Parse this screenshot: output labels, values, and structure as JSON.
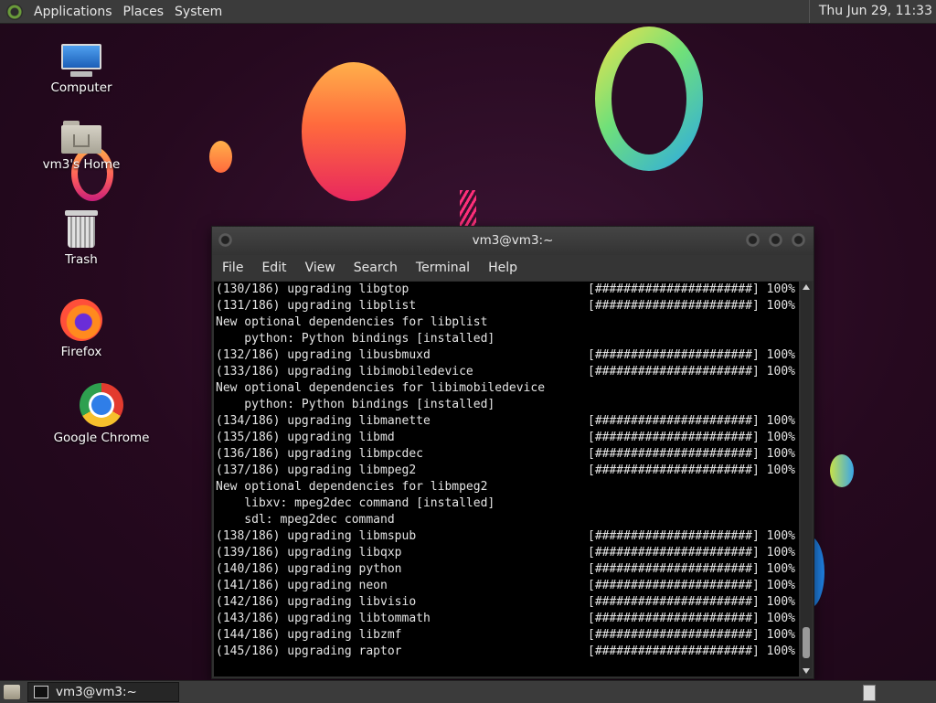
{
  "top_panel": {
    "menus": [
      "Applications",
      "Places",
      "System"
    ],
    "clock": "Thu Jun 29, 11:33"
  },
  "desktop_icons": [
    {
      "label": "Computer",
      "icon": "computer-icon"
    },
    {
      "label": "vm3's Home",
      "icon": "home-folder-icon"
    },
    {
      "label": "Trash",
      "icon": "trash-icon"
    },
    {
      "label": "Firefox",
      "icon": "firefox-icon"
    },
    {
      "label": "Google Chrome",
      "icon": "chrome-icon"
    }
  ],
  "terminal": {
    "title": "vm3@vm3:~",
    "menu": [
      "File",
      "Edit",
      "View",
      "Search",
      "Terminal",
      "Help"
    ],
    "lines": [
      {
        "text": "(130/186) upgrading libgtop",
        "progress": "[######################] 100%"
      },
      {
        "text": "(131/186) upgrading libplist",
        "progress": "[######################] 100%"
      },
      {
        "text": "New optional dependencies for libplist",
        "progress": ""
      },
      {
        "text": "    python: Python bindings [installed]",
        "progress": ""
      },
      {
        "text": "(132/186) upgrading libusbmuxd",
        "progress": "[######################] 100%"
      },
      {
        "text": "(133/186) upgrading libimobiledevice",
        "progress": "[######################] 100%"
      },
      {
        "text": "New optional dependencies for libimobiledevice",
        "progress": ""
      },
      {
        "text": "    python: Python bindings [installed]",
        "progress": ""
      },
      {
        "text": "(134/186) upgrading libmanette",
        "progress": "[######################] 100%"
      },
      {
        "text": "(135/186) upgrading libmd",
        "progress": "[######################] 100%"
      },
      {
        "text": "(136/186) upgrading libmpcdec",
        "progress": "[######################] 100%"
      },
      {
        "text": "(137/186) upgrading libmpeg2",
        "progress": "[######################] 100%"
      },
      {
        "text": "New optional dependencies for libmpeg2",
        "progress": ""
      },
      {
        "text": "    libxv: mpeg2dec command [installed]",
        "progress": ""
      },
      {
        "text": "    sdl: mpeg2dec command",
        "progress": ""
      },
      {
        "text": "(138/186) upgrading libmspub",
        "progress": "[######################] 100%"
      },
      {
        "text": "(139/186) upgrading libqxp",
        "progress": "[######################] 100%"
      },
      {
        "text": "(140/186) upgrading python",
        "progress": "[######################] 100%"
      },
      {
        "text": "(141/186) upgrading neon",
        "progress": "[######################] 100%"
      },
      {
        "text": "(142/186) upgrading libvisio",
        "progress": "[######################] 100%"
      },
      {
        "text": "(143/186) upgrading libtommath",
        "progress": "[######################] 100%"
      },
      {
        "text": "(144/186) upgrading libzmf",
        "progress": "[######################] 100%"
      },
      {
        "text": "(145/186) upgrading raptor",
        "progress": "[######################] 100%"
      }
    ]
  },
  "taskbar": {
    "tasks": [
      {
        "label": "vm3@vm3:~"
      }
    ]
  }
}
